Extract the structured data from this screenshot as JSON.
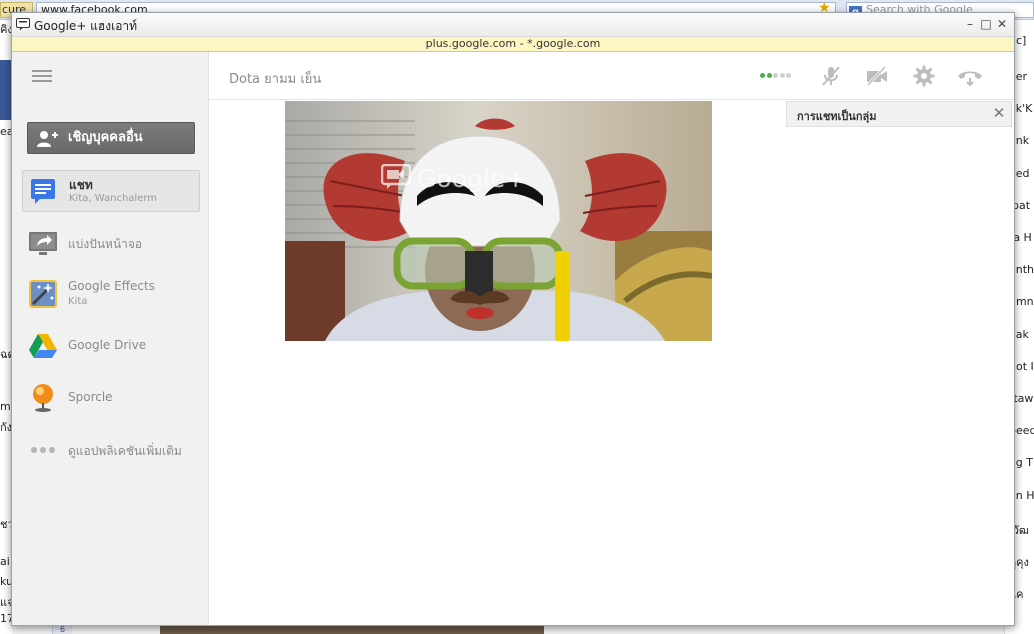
{
  "background_browser": {
    "secure_label": "cure",
    "address": "www.facebook.com",
    "search_placeholder": "Search with Google",
    "left_edge_text": [
      "คิง",
      "ea",
      "ฉด",
      "mi",
      "กัง",
      "ชว",
      "ai",
      "ku",
      "แจ",
      "17+1..."
    ],
    "right_edge_text": [
      "gc]",
      "eer",
      "ak'K",
      "ank",
      "eed",
      "ipat",
      "ta H",
      "onth",
      "umn",
      "eak",
      "not I",
      "ttaw",
      "peed",
      "ag T",
      "an H",
      "เวัฒ",
      "ดูคุง",
      "แค"
    ],
    "bottom_badge": "6"
  },
  "window": {
    "title": "Google+ แฮงเอาท์",
    "url_bar": "plus.google.com - *.google.com",
    "controls": {
      "minimize": "–",
      "maximize": "□",
      "close": "✕"
    }
  },
  "sidebar": {
    "menu_icon": "hamburger-menu-icon",
    "invite_button": "เชิญบุคคลอื่น",
    "apps": [
      {
        "label": "แชท",
        "sub": "Kita, Wanchalerm",
        "icon": "chat-icon",
        "active": true
      },
      {
        "label": "แบ่งปันหน้าจอ",
        "sub": "",
        "icon": "screen-share-icon",
        "active": false
      },
      {
        "label": "Google Effects",
        "sub": "Kita",
        "icon": "google-effects-icon",
        "active": false
      },
      {
        "label": "Google Drive",
        "sub": "",
        "icon": "google-drive-icon",
        "active": false
      },
      {
        "label": "Sporcle",
        "sub": "",
        "icon": "sporcle-icon",
        "active": false
      },
      {
        "label": "ดูแอปพลิเคชันเพิ่มเติม",
        "sub": "",
        "icon": "more-apps-icon",
        "active": false
      }
    ]
  },
  "main": {
    "participant_names": "Dota ยามม เย็น",
    "bandwidth_dots": {
      "active": 2,
      "total": 5
    },
    "controls": [
      "microphone-muted-icon",
      "camera-off-icon",
      "settings-icon",
      "hang-up-icon"
    ],
    "video_watermark": "Google+",
    "group_chat": {
      "title": "การแชทเป็นกลุ่ม",
      "close": "✕"
    }
  },
  "colors": {
    "invite_button_bg": "#737373",
    "url_bar_bg": "#fdf6c3",
    "bandwidth_active": "#4caf50",
    "sidebar_bg": "#f1f1f1"
  }
}
